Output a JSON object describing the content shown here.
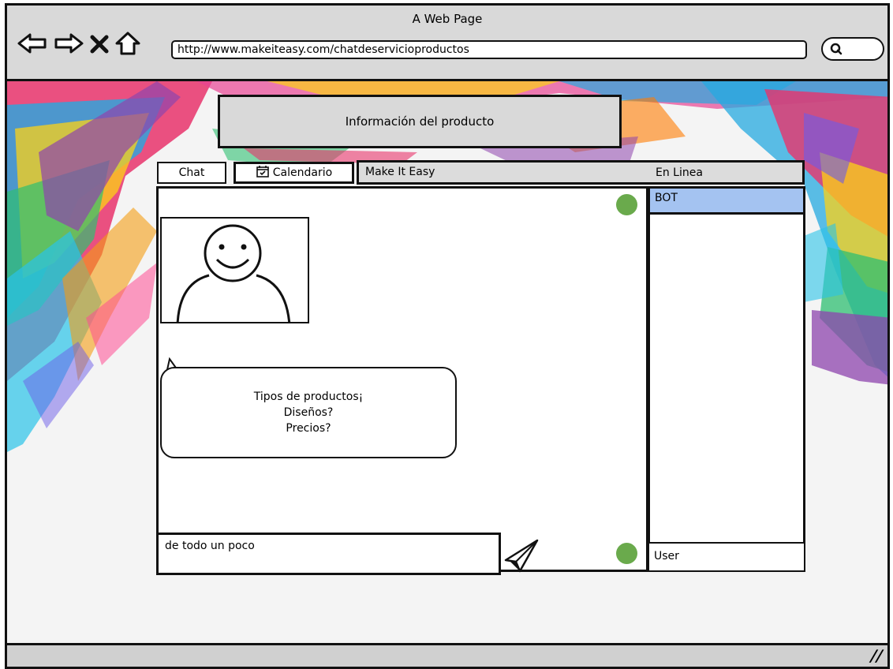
{
  "browser": {
    "window_title": "A Web Page",
    "url": "http://www.makeiteasy.com/chatdeservicioproductos",
    "nav_icons": [
      "back-arrow-icon",
      "forward-arrow-icon",
      "stop-icon",
      "home-icon"
    ],
    "search_icon": "search-icon"
  },
  "page": {
    "info_title": "Información del producto",
    "tabs": [
      {
        "label": "Chat",
        "icon": ""
      },
      {
        "label": "Calendario",
        "icon": "calendar-icon"
      }
    ],
    "chat_header": {
      "name": "Make It Easy",
      "online_label": "En Linea"
    },
    "bot_message": {
      "lines": [
        "Tipos de productos¡",
        "Diseños?",
        "Precios?"
      ]
    },
    "message_input": {
      "value": "de todo un poco"
    },
    "users": [
      {
        "name": "BOT",
        "selected": true
      },
      {
        "name": "User",
        "selected": false
      }
    ],
    "status_color": "#6aaa4c",
    "selected_color": "#a4c3f1"
  }
}
